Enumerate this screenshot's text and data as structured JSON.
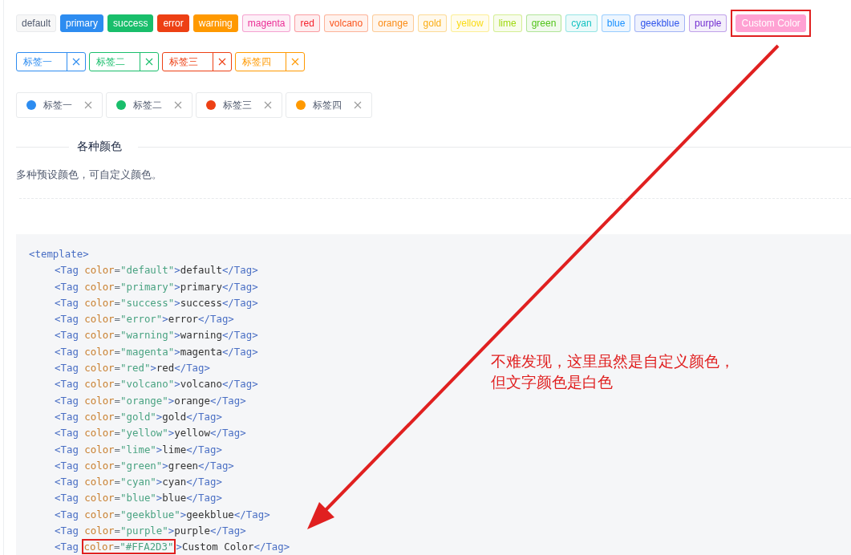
{
  "color_tags": [
    {
      "label": "default",
      "kind": "plain",
      "color": "#515a6e",
      "highlighted": false
    },
    {
      "label": "primary",
      "kind": "solid",
      "color": "#2d8cf0",
      "highlighted": false
    },
    {
      "label": "success",
      "kind": "solid",
      "color": "#19be6b",
      "highlighted": false
    },
    {
      "label": "error",
      "kind": "solid",
      "color": "#ed4014",
      "highlighted": false
    },
    {
      "label": "warning",
      "kind": "solid",
      "color": "#ff9900",
      "highlighted": false
    },
    {
      "label": "magenta",
      "kind": "light",
      "color": "#eb2f96",
      "highlighted": false
    },
    {
      "label": "red",
      "kind": "light",
      "color": "#f5222d",
      "highlighted": false
    },
    {
      "label": "volcano",
      "kind": "light",
      "color": "#fa541c",
      "highlighted": false
    },
    {
      "label": "orange",
      "kind": "light",
      "color": "#fa8c16",
      "highlighted": false
    },
    {
      "label": "gold",
      "kind": "light",
      "color": "#faad14",
      "highlighted": false
    },
    {
      "label": "yellow",
      "kind": "light",
      "color": "#fadb14",
      "highlighted": false
    },
    {
      "label": "lime",
      "kind": "light",
      "color": "#a0d911",
      "highlighted": false
    },
    {
      "label": "green",
      "kind": "light",
      "color": "#52c41a",
      "highlighted": false
    },
    {
      "label": "cyan",
      "kind": "light",
      "color": "#13c2c2",
      "highlighted": false
    },
    {
      "label": "blue",
      "kind": "light",
      "color": "#1890ff",
      "highlighted": false
    },
    {
      "label": "geekblue",
      "kind": "light",
      "color": "#2f54eb",
      "highlighted": false
    },
    {
      "label": "purple",
      "kind": "light",
      "color": "#722ed1",
      "highlighted": false
    },
    {
      "label": "Custom Color",
      "kind": "solid",
      "color": "#ffa2d3",
      "highlighted": true
    }
  ],
  "border_tags": [
    {
      "label": "标签一",
      "color": "#2d8cf0"
    },
    {
      "label": "标签二",
      "color": "#19be6b"
    },
    {
      "label": "标签三",
      "color": "#ed4014"
    },
    {
      "label": "标签四",
      "color": "#ff9900"
    }
  ],
  "dot_tags": [
    {
      "label": "标签一",
      "color": "#2d8cf0"
    },
    {
      "label": "标签二",
      "color": "#19be6b"
    },
    {
      "label": "标签三",
      "color": "#ed4014"
    },
    {
      "label": "标签四",
      "color": "#ff9900"
    }
  ],
  "section": {
    "title": "各种颜色",
    "description": "多种预设颜色，可自定义颜色。"
  },
  "code": {
    "lines": [
      {
        "tokens": [
          {
            "kind": "tag",
            "text": "<template>"
          }
        ],
        "children": [
          {
            "tokens": [
              {
                "kind": "tag",
                "text": "<Tag"
              },
              {
                "kind": "attr",
                "text": "color"
              },
              {
                "kind": "punct",
                "text": "="
              },
              {
                "kind": "string",
                "text": "\"default\""
              },
              {
                "kind": "tag",
                "text": ">"
              },
              {
                "kind": "plain",
                "text": "default"
              },
              {
                "kind": "tag",
                "text": "</Tag>"
              }
            ]
          },
          {
            "tokens": [
              {
                "kind": "tag",
                "text": "<Tag"
              },
              {
                "kind": "attr",
                "text": "color"
              },
              {
                "kind": "punct",
                "text": "="
              },
              {
                "kind": "string",
                "text": "\"primary\""
              },
              {
                "kind": "tag",
                "text": ">"
              },
              {
                "kind": "plain",
                "text": "primary"
              },
              {
                "kind": "tag",
                "text": "</Tag>"
              }
            ]
          },
          {
            "tokens": [
              {
                "kind": "tag",
                "text": "<Tag"
              },
              {
                "kind": "attr",
                "text": "color"
              },
              {
                "kind": "punct",
                "text": "="
              },
              {
                "kind": "string",
                "text": "\"success\""
              },
              {
                "kind": "tag",
                "text": ">"
              },
              {
                "kind": "plain",
                "text": "success"
              },
              {
                "kind": "tag",
                "text": "</Tag>"
              }
            ]
          },
          {
            "tokens": [
              {
                "kind": "tag",
                "text": "<Tag"
              },
              {
                "kind": "attr",
                "text": "color"
              },
              {
                "kind": "punct",
                "text": "="
              },
              {
                "kind": "string",
                "text": "\"error\""
              },
              {
                "kind": "tag",
                "text": ">"
              },
              {
                "kind": "plain",
                "text": "error"
              },
              {
                "kind": "tag",
                "text": "</Tag>"
              }
            ]
          },
          {
            "tokens": [
              {
                "kind": "tag",
                "text": "<Tag"
              },
              {
                "kind": "attr",
                "text": "color"
              },
              {
                "kind": "punct",
                "text": "="
              },
              {
                "kind": "string",
                "text": "\"warning\""
              },
              {
                "kind": "tag",
                "text": ">"
              },
              {
                "kind": "plain",
                "text": "warning"
              },
              {
                "kind": "tag",
                "text": "</Tag>"
              }
            ]
          },
          {
            "tokens": [
              {
                "kind": "tag",
                "text": "<Tag"
              },
              {
                "kind": "attr",
                "text": "color"
              },
              {
                "kind": "punct",
                "text": "="
              },
              {
                "kind": "string",
                "text": "\"magenta\""
              },
              {
                "kind": "tag",
                "text": ">"
              },
              {
                "kind": "plain",
                "text": "magenta"
              },
              {
                "kind": "tag",
                "text": "</Tag>"
              }
            ]
          },
          {
            "tokens": [
              {
                "kind": "tag",
                "text": "<Tag"
              },
              {
                "kind": "attr",
                "text": "color"
              },
              {
                "kind": "punct",
                "text": "="
              },
              {
                "kind": "string",
                "text": "\"red\""
              },
              {
                "kind": "tag",
                "text": ">"
              },
              {
                "kind": "plain",
                "text": "red"
              },
              {
                "kind": "tag",
                "text": "</Tag>"
              }
            ]
          },
          {
            "tokens": [
              {
                "kind": "tag",
                "text": "<Tag"
              },
              {
                "kind": "attr",
                "text": "color"
              },
              {
                "kind": "punct",
                "text": "="
              },
              {
                "kind": "string",
                "text": "\"volcano\""
              },
              {
                "kind": "tag",
                "text": ">"
              },
              {
                "kind": "plain",
                "text": "volcano"
              },
              {
                "kind": "tag",
                "text": "</Tag>"
              }
            ]
          },
          {
            "tokens": [
              {
                "kind": "tag",
                "text": "<Tag"
              },
              {
                "kind": "attr",
                "text": "color"
              },
              {
                "kind": "punct",
                "text": "="
              },
              {
                "kind": "string",
                "text": "\"orange\""
              },
              {
                "kind": "tag",
                "text": ">"
              },
              {
                "kind": "plain",
                "text": "orange"
              },
              {
                "kind": "tag",
                "text": "</Tag>"
              }
            ]
          },
          {
            "tokens": [
              {
                "kind": "tag",
                "text": "<Tag"
              },
              {
                "kind": "attr",
                "text": "color"
              },
              {
                "kind": "punct",
                "text": "="
              },
              {
                "kind": "string",
                "text": "\"gold\""
              },
              {
                "kind": "tag",
                "text": ">"
              },
              {
                "kind": "plain",
                "text": "gold"
              },
              {
                "kind": "tag",
                "text": "</Tag>"
              }
            ]
          },
          {
            "tokens": [
              {
                "kind": "tag",
                "text": "<Tag"
              },
              {
                "kind": "attr",
                "text": "color"
              },
              {
                "kind": "punct",
                "text": "="
              },
              {
                "kind": "string",
                "text": "\"yellow\""
              },
              {
                "kind": "tag",
                "text": ">"
              },
              {
                "kind": "plain",
                "text": "yellow"
              },
              {
                "kind": "tag",
                "text": "</Tag>"
              }
            ]
          },
          {
            "tokens": [
              {
                "kind": "tag",
                "text": "<Tag"
              },
              {
                "kind": "attr",
                "text": "color"
              },
              {
                "kind": "punct",
                "text": "="
              },
              {
                "kind": "string",
                "text": "\"lime\""
              },
              {
                "kind": "tag",
                "text": ">"
              },
              {
                "kind": "plain",
                "text": "lime"
              },
              {
                "kind": "tag",
                "text": "</Tag>"
              }
            ]
          },
          {
            "tokens": [
              {
                "kind": "tag",
                "text": "<Tag"
              },
              {
                "kind": "attr",
                "text": "color"
              },
              {
                "kind": "punct",
                "text": "="
              },
              {
                "kind": "string",
                "text": "\"green\""
              },
              {
                "kind": "tag",
                "text": ">"
              },
              {
                "kind": "plain",
                "text": "green"
              },
              {
                "kind": "tag",
                "text": "</Tag>"
              }
            ]
          },
          {
            "tokens": [
              {
                "kind": "tag",
                "text": "<Tag"
              },
              {
                "kind": "attr",
                "text": "color"
              },
              {
                "kind": "punct",
                "text": "="
              },
              {
                "kind": "string",
                "text": "\"cyan\""
              },
              {
                "kind": "tag",
                "text": ">"
              },
              {
                "kind": "plain",
                "text": "cyan"
              },
              {
                "kind": "tag",
                "text": "</Tag>"
              }
            ]
          },
          {
            "tokens": [
              {
                "kind": "tag",
                "text": "<Tag"
              },
              {
                "kind": "attr",
                "text": "color"
              },
              {
                "kind": "punct",
                "text": "="
              },
              {
                "kind": "string",
                "text": "\"blue\""
              },
              {
                "kind": "tag",
                "text": ">"
              },
              {
                "kind": "plain",
                "text": "blue"
              },
              {
                "kind": "tag",
                "text": "</Tag>"
              }
            ]
          },
          {
            "tokens": [
              {
                "kind": "tag",
                "text": "<Tag"
              },
              {
                "kind": "attr",
                "text": "color"
              },
              {
                "kind": "punct",
                "text": "="
              },
              {
                "kind": "string",
                "text": "\"geekblue\""
              },
              {
                "kind": "tag",
                "text": ">"
              },
              {
                "kind": "plain",
                "text": "geekblue"
              },
              {
                "kind": "tag",
                "text": "</Tag>"
              }
            ]
          },
          {
            "tokens": [
              {
                "kind": "tag",
                "text": "<Tag"
              },
              {
                "kind": "attr",
                "text": "color"
              },
              {
                "kind": "punct",
                "text": "="
              },
              {
                "kind": "string",
                "text": "\"purple\""
              },
              {
                "kind": "tag",
                "text": ">"
              },
              {
                "kind": "plain",
                "text": "purple"
              },
              {
                "kind": "tag",
                "text": "</Tag>"
              }
            ]
          },
          {
            "tokens": [
              {
                "kind": "tag",
                "text": "<Tag"
              }
            ],
            "boxed": [
              {
                "kind": "attr",
                "text": "color"
              },
              {
                "kind": "punct",
                "text": "="
              },
              {
                "kind": "string",
                "text": "\"#FFA2D3\""
              }
            ],
            "rest": [
              {
                "kind": "tag",
                "text": ">"
              },
              {
                "kind": "plain",
                "text": "Custom Color"
              },
              {
                "kind": "tag",
                "text": "</Tag>"
              }
            ]
          }
        ]
      }
    ]
  },
  "annotation": {
    "lines": [
      "不难发现，这里虽然是自定义颜色，",
      "但文字颜色是白色"
    ]
  }
}
